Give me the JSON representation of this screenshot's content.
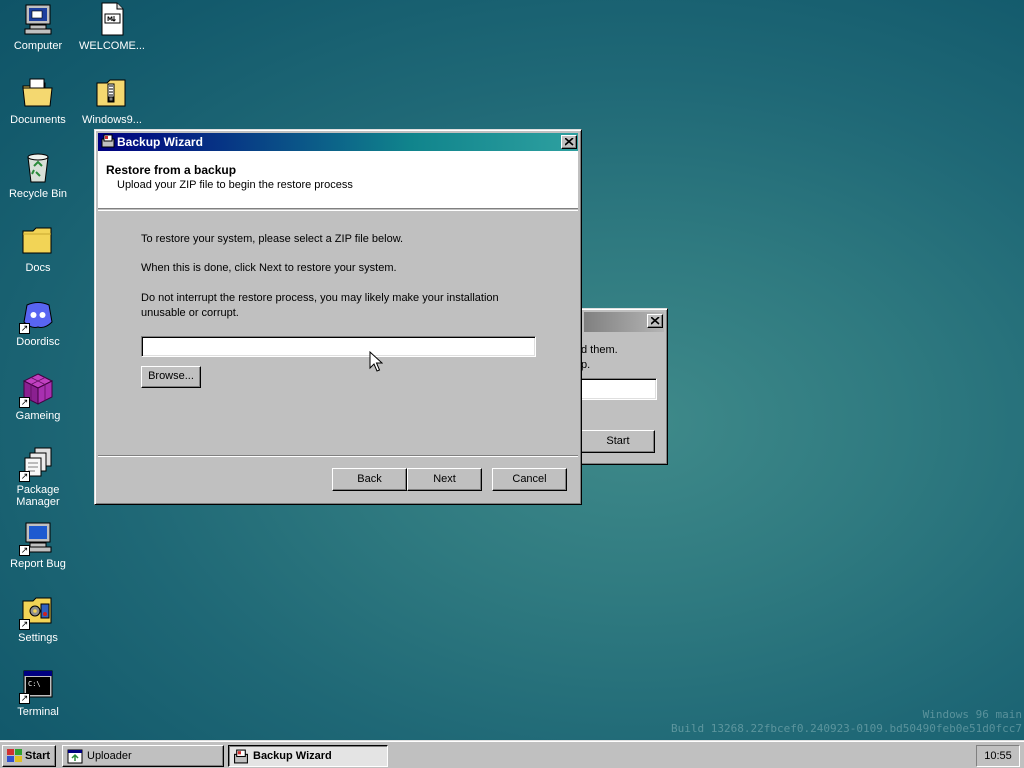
{
  "desktop": {
    "icons": [
      {
        "label": "Computer",
        "icon": "computer-icon"
      },
      {
        "label": "WELCOME...",
        "icon": "markdown-file-icon"
      },
      {
        "label": "Documents",
        "icon": "documents-folder-icon"
      },
      {
        "label": "Windows9...",
        "icon": "zip-folder-icon"
      },
      {
        "label": "Recycle Bin",
        "icon": "recycle-bin-icon"
      },
      {
        "label": "Docs",
        "icon": "folder-icon"
      },
      {
        "label": "Doordisc",
        "icon": "doordisc-icon"
      },
      {
        "label": "Gameing",
        "icon": "game-cube-icon"
      },
      {
        "label": "Package Manager",
        "icon": "package-manager-icon"
      },
      {
        "label": "Report Bug",
        "icon": "report-bug-icon"
      },
      {
        "label": "Settings",
        "icon": "settings-icon"
      },
      {
        "label": "Terminal",
        "icon": "terminal-icon"
      }
    ],
    "build_info": {
      "line1": "Windows 96 main",
      "line2": "Build 13268.22fbcef0.240923-0109.bd50490feb0e51d0fcc7"
    }
  },
  "uploader_window": {
    "text_line1": "d them.",
    "text_line2": "p.",
    "start_button": "Start"
  },
  "wizard": {
    "title": "Backup Wizard",
    "header_title": "Restore from a backup",
    "header_subtitle": "Upload your ZIP file to begin the restore process",
    "instruction1": "To restore your system, please select a ZIP file below.",
    "instruction2": "When this is done, click Next to restore your system.",
    "instruction3": "Do not interrupt the restore process, you may likely make your installation unusable or corrupt.",
    "file_path_value": "",
    "browse_button": "Browse...",
    "back_button": "Back",
    "next_button": "Next",
    "cancel_button": "Cancel"
  },
  "taskbar": {
    "start_label": "Start",
    "tasks": [
      {
        "label": "Uploader",
        "active": false
      },
      {
        "label": "Backup Wizard",
        "active": true
      }
    ],
    "clock": "10:55"
  },
  "colors": {
    "desktop_teal": "#1f6876",
    "title_active_start": "#000080",
    "title_active_end": "#2ea0a0",
    "face": "#c0c0c0"
  }
}
